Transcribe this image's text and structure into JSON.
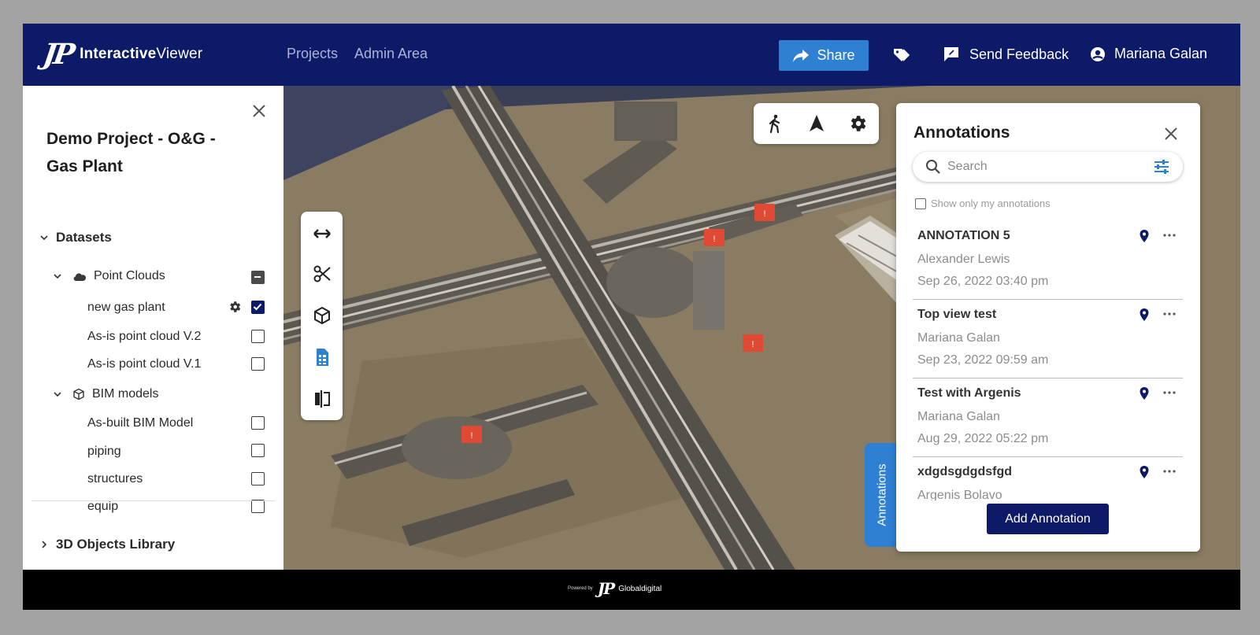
{
  "header": {
    "logo_mark": "JP",
    "logo_text_bold": "Interactive",
    "logo_text_rest": "Viewer",
    "nav": [
      "Projects",
      "Admin Area"
    ],
    "share_label": "Share",
    "feedback_label": "Send Feedback",
    "user_name": "Mariana Galan",
    "icons": {
      "share": "share-arrow-icon",
      "tag": "tag-icon",
      "feedback": "feedback-icon",
      "user": "user-circle-icon"
    }
  },
  "left_panel": {
    "project_title": "Demo Project - O&G - Gas Plant",
    "datasets_label": "Datasets",
    "point_clouds": {
      "label": "Point Clouds",
      "state": "partial",
      "items": [
        {
          "label": "new gas plant",
          "checked": true,
          "has_settings": true
        },
        {
          "label": "As-is point cloud V.2",
          "checked": false
        },
        {
          "label": "As-is point cloud V.1",
          "checked": false
        }
      ]
    },
    "bim_models": {
      "label": "BIM models",
      "items": [
        {
          "label": "As-built BIM Model",
          "checked": false
        },
        {
          "label": "piping",
          "checked": false
        },
        {
          "label": "structures",
          "checked": false
        },
        {
          "label": "equip",
          "checked": false
        }
      ]
    },
    "objects_library_label": "3D Objects Library"
  },
  "viewport": {
    "side_tools": [
      "measure-icon",
      "cut-icon",
      "cube-icon",
      "report-icon",
      "compare-icon"
    ],
    "top_tools": [
      "walk-icon",
      "navigate-icon",
      "settings-icon"
    ]
  },
  "annotations": {
    "tab_label": "Annotations",
    "title": "Annotations",
    "search_placeholder": "Search",
    "filter_label": "Show only my annotations",
    "items": [
      {
        "name": "ANNOTATION 5",
        "author": "Alexander Lewis",
        "date": "Sep 26, 2022 03:40 pm"
      },
      {
        "name": "Top view test",
        "author": "Mariana Galan",
        "date": "Sep 23, 2022 09:59 am"
      },
      {
        "name": "Test with Argenis",
        "author": "Mariana Galan",
        "date": "Aug 29, 2022 05:22 pm"
      },
      {
        "name": "xdgdsgdgdsfgd",
        "author": "Argenis Bolavo",
        "date": ""
      }
    ],
    "add_label": "Add Annotation"
  },
  "footer": {
    "powered_by": "Powered by",
    "brand_mark": "JP",
    "brand": "Globaldigital"
  },
  "colors": {
    "header_bg": "#0d1a68",
    "accent": "#2f7fd3",
    "marker": "#e04a34"
  }
}
